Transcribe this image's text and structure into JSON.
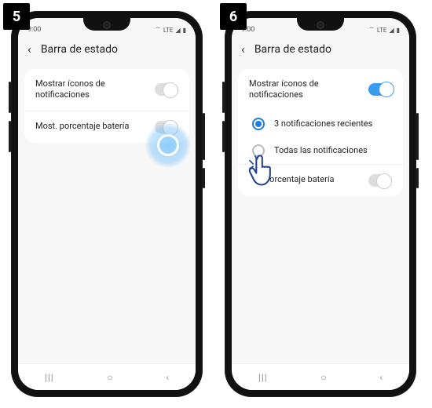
{
  "steps": {
    "five": "5",
    "six": "6"
  },
  "status": {
    "time": "9:00",
    "wifi": "⧋",
    "lte": "LTE",
    "signal": "◢",
    "battery": "▮"
  },
  "header": {
    "back": "‹",
    "title": "Barra de estado"
  },
  "screen5": {
    "row1": "Mostrar íconos de notificaciones",
    "row2": "Most. porcentaje batería"
  },
  "screen6": {
    "row1": "Mostrar íconos de notificaciones",
    "opt1": "3 notificaciones recientes",
    "opt2": "Todas las notificaciones",
    "row2_partial": "porcentaje batería"
  },
  "nav": {
    "recent": "|||",
    "home": "○",
    "back": "‹"
  }
}
